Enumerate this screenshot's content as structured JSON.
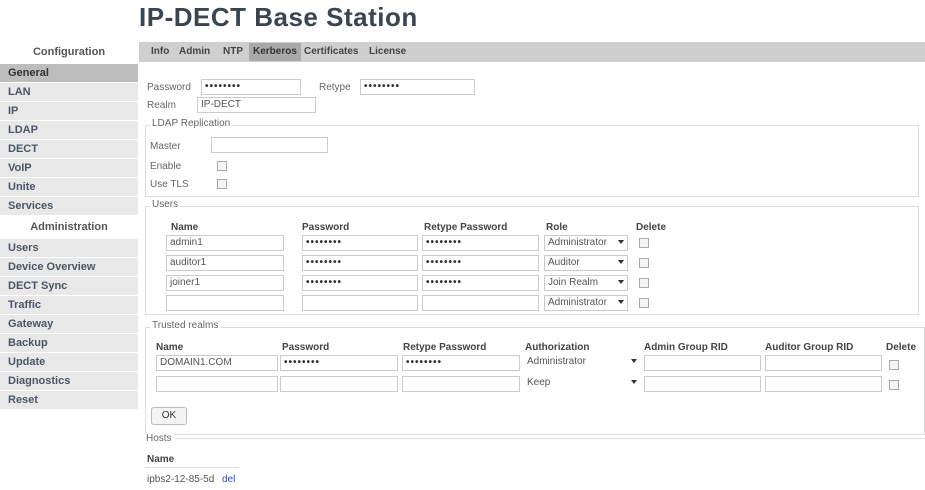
{
  "page_title": "IP-DECT Base Station",
  "sidebar": {
    "config_heading": "Configuration",
    "config_items": [
      {
        "label": "General",
        "active": true
      },
      {
        "label": "LAN"
      },
      {
        "label": "IP"
      },
      {
        "label": "LDAP"
      },
      {
        "label": "DECT"
      },
      {
        "label": "VoIP"
      },
      {
        "label": "Unite"
      },
      {
        "label": "Services"
      }
    ],
    "admin_heading": "Administration",
    "admin_items": [
      {
        "label": "Users"
      },
      {
        "label": "Device Overview"
      },
      {
        "label": "DECT Sync"
      },
      {
        "label": "Traffic"
      },
      {
        "label": "Gateway"
      },
      {
        "label": "Backup"
      },
      {
        "label": "Update"
      },
      {
        "label": "Diagnostics"
      },
      {
        "label": "Reset"
      }
    ]
  },
  "tabs": [
    {
      "label": "Info"
    },
    {
      "label": "Admin"
    },
    {
      "label": "NTP"
    },
    {
      "label": "Kerberos",
      "active": true
    },
    {
      "label": "Certificates"
    },
    {
      "label": "License"
    }
  ],
  "form": {
    "password_label": "Password",
    "password_value": "••••••••",
    "retype_label": "Retype",
    "retype_value": "••••••••",
    "realm_label": "Realm",
    "realm_value": "IP-DECT",
    "ldap": {
      "legend": "LDAP Replication",
      "master_label": "Master",
      "master_value": "",
      "enable_label": "Enable",
      "use_tls_label": "Use TLS"
    },
    "users": {
      "legend": "Users",
      "headers": {
        "name": "Name",
        "password": "Password",
        "retype": "Retype Password",
        "role": "Role",
        "delete": "Delete"
      },
      "rows": [
        {
          "name": "admin1",
          "password": "••••••••",
          "retype": "••••••••",
          "role": "Administrator"
        },
        {
          "name": "auditor1",
          "password": "••••••••",
          "retype": "••••••••",
          "role": "Auditor"
        },
        {
          "name": "joiner1",
          "password": "••••••••",
          "retype": "••••••••",
          "role": "Join Realm"
        },
        {
          "name": "",
          "password": "",
          "retype": "",
          "role": "Administrator"
        }
      ]
    },
    "trusted": {
      "legend": "Trusted realms",
      "headers": {
        "name": "Name",
        "password": "Password",
        "retype": "Retype Password",
        "authorization": "Authorization",
        "admin_rid": "Admin Group RID",
        "auditor_rid": "Auditor Group RID",
        "delete": "Delete"
      },
      "rows": [
        {
          "name": "DOMAIN1.COM",
          "password": "••••••••",
          "retype": "••••••••",
          "authorization": "Administrator",
          "admin_rid": "",
          "auditor_rid": ""
        },
        {
          "name": "",
          "password": "",
          "retype": "",
          "authorization": "Keep",
          "admin_rid": "",
          "auditor_rid": ""
        }
      ]
    },
    "ok_label": "OK"
  },
  "hosts": {
    "legend": "Hosts",
    "name_header": "Name",
    "items": [
      {
        "name": "ipbs2-12-85-5d",
        "action": "del"
      }
    ]
  }
}
